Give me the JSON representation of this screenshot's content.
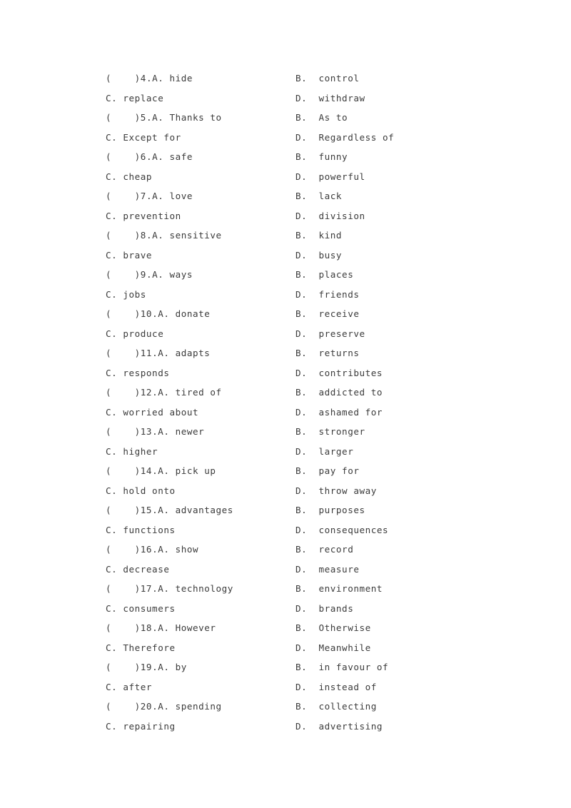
{
  "page": {
    "background_color": "#ffffff",
    "text_color": "#3b3b3b",
    "paren_blank": "(    )",
    "option_separator": ". "
  },
  "questions": [
    {
      "number": "4",
      "A": {
        "letter": "A.",
        "text": "hide"
      },
      "B": {
        "letter": "B.",
        "text": "control"
      },
      "C": {
        "letter": "C.",
        "text": "replace"
      },
      "D": {
        "letter": "D.",
        "text": "withdraw"
      }
    },
    {
      "number": "5",
      "A": {
        "letter": "A.",
        "text": "Thanks to"
      },
      "B": {
        "letter": "B.",
        "text": "As to"
      },
      "C": {
        "letter": "C.",
        "text": "Except for"
      },
      "D": {
        "letter": "D.",
        "text": "Regardless of"
      }
    },
    {
      "number": "6",
      "A": {
        "letter": "A.",
        "text": "safe"
      },
      "B": {
        "letter": "B.",
        "text": "funny"
      },
      "C": {
        "letter": "C.",
        "text": "cheap"
      },
      "D": {
        "letter": "D.",
        "text": "powerful"
      }
    },
    {
      "number": "7",
      "A": {
        "letter": "A.",
        "text": "love"
      },
      "B": {
        "letter": "B.",
        "text": "lack"
      },
      "C": {
        "letter": "C.",
        "text": "prevention"
      },
      "D": {
        "letter": "D.",
        "text": "division"
      }
    },
    {
      "number": "8",
      "A": {
        "letter": "A.",
        "text": "sensitive"
      },
      "B": {
        "letter": "B.",
        "text": "kind"
      },
      "C": {
        "letter": "C.",
        "text": "brave"
      },
      "D": {
        "letter": "D.",
        "text": "busy"
      }
    },
    {
      "number": "9",
      "A": {
        "letter": "A.",
        "text": "ways"
      },
      "B": {
        "letter": "B.",
        "text": "places"
      },
      "C": {
        "letter": "C.",
        "text": "jobs"
      },
      "D": {
        "letter": "D.",
        "text": "friends"
      }
    },
    {
      "number": "10",
      "A": {
        "letter": "A.",
        "text": "donate"
      },
      "B": {
        "letter": "B.",
        "text": "receive"
      },
      "C": {
        "letter": "C.",
        "text": "produce"
      },
      "D": {
        "letter": "D.",
        "text": "preserve"
      }
    },
    {
      "number": "11",
      "A": {
        "letter": "A.",
        "text": "adapts"
      },
      "B": {
        "letter": "B.",
        "text": "returns"
      },
      "C": {
        "letter": "C.",
        "text": "responds"
      },
      "D": {
        "letter": "D.",
        "text": "contributes"
      }
    },
    {
      "number": "12",
      "A": {
        "letter": "A.",
        "text": "tired of"
      },
      "B": {
        "letter": "B.",
        "text": "addicted to"
      },
      "C": {
        "letter": "C.",
        "text": "worried about"
      },
      "D": {
        "letter": "D.",
        "text": "ashamed for"
      }
    },
    {
      "number": "13",
      "A": {
        "letter": "A.",
        "text": "newer"
      },
      "B": {
        "letter": "B.",
        "text": "stronger"
      },
      "C": {
        "letter": "C.",
        "text": "higher"
      },
      "D": {
        "letter": "D.",
        "text": "larger"
      }
    },
    {
      "number": "14",
      "A": {
        "letter": "A.",
        "text": "pick up"
      },
      "B": {
        "letter": "B.",
        "text": "pay for"
      },
      "C": {
        "letter": "C.",
        "text": "hold onto"
      },
      "D": {
        "letter": "D.",
        "text": "throw away"
      }
    },
    {
      "number": "15",
      "A": {
        "letter": "A.",
        "text": "advantages"
      },
      "B": {
        "letter": "B.",
        "text": "purposes"
      },
      "C": {
        "letter": "C.",
        "text": "functions"
      },
      "D": {
        "letter": "D.",
        "text": "consequences"
      }
    },
    {
      "number": "16",
      "A": {
        "letter": "A.",
        "text": "show"
      },
      "B": {
        "letter": "B.",
        "text": "record"
      },
      "C": {
        "letter": "C.",
        "text": "decrease"
      },
      "D": {
        "letter": "D.",
        "text": "measure"
      }
    },
    {
      "number": "17",
      "A": {
        "letter": "A.",
        "text": "technology"
      },
      "B": {
        "letter": "B.",
        "text": "environment"
      },
      "C": {
        "letter": "C.",
        "text": "consumers"
      },
      "D": {
        "letter": "D.",
        "text": "brands"
      }
    },
    {
      "number": "18",
      "A": {
        "letter": "A.",
        "text": "However"
      },
      "B": {
        "letter": "B.",
        "text": "Otherwise"
      },
      "C": {
        "letter": "C.",
        "text": "Therefore"
      },
      "D": {
        "letter": "D.",
        "text": "Meanwhile"
      }
    },
    {
      "number": "19",
      "A": {
        "letter": "A.",
        "text": "by"
      },
      "B": {
        "letter": "B.",
        "text": "in favour of"
      },
      "C": {
        "letter": "C.",
        "text": "after"
      },
      "D": {
        "letter": "D.",
        "text": "instead of"
      }
    },
    {
      "number": "20",
      "A": {
        "letter": "A.",
        "text": "spending"
      },
      "B": {
        "letter": "B.",
        "text": "collecting"
      },
      "C": {
        "letter": "C.",
        "text": "repairing"
      },
      "D": {
        "letter": "D.",
        "text": "advertising"
      }
    }
  ]
}
